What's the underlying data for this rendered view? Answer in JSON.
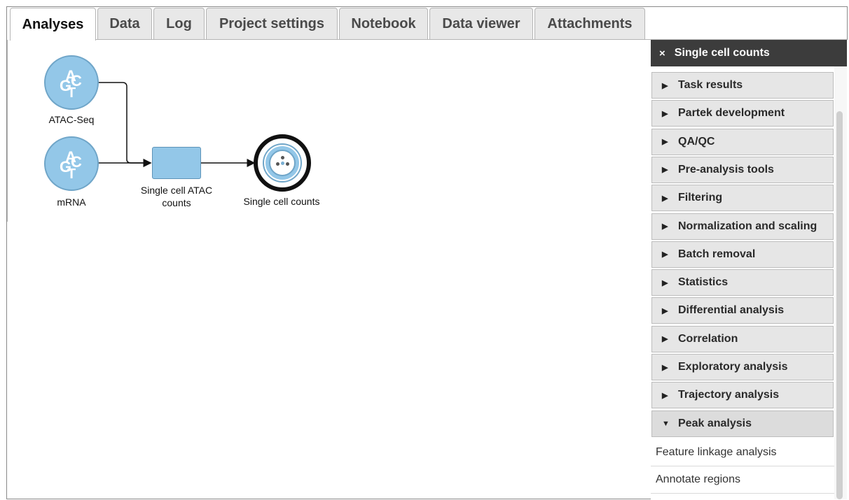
{
  "tabs": [
    {
      "label": "Analyses",
      "active": true
    },
    {
      "label": "Data",
      "active": false
    },
    {
      "label": "Log",
      "active": false
    },
    {
      "label": "Project settings",
      "active": false
    },
    {
      "label": "Notebook",
      "active": false
    },
    {
      "label": "Data viewer",
      "active": false
    },
    {
      "label": "Attachments",
      "active": false
    }
  ],
  "canvas": {
    "nodes": {
      "atac": {
        "label": "ATAC-Seq",
        "icon": "dna-data-icon"
      },
      "mrna": {
        "label": "mRNA",
        "icon": "dna-data-icon"
      },
      "task": {
        "label_line1": "Single cell ATAC",
        "label_line2": "counts"
      },
      "counts": {
        "label": "Single cell counts",
        "icon": "single-cell-icon"
      }
    }
  },
  "panel": {
    "title": "Single cell counts",
    "close_icon": "×",
    "sections": [
      {
        "label": "Task results",
        "expanded": false
      },
      {
        "label": "Partek development",
        "expanded": false
      },
      {
        "label": "QA/QC",
        "expanded": false
      },
      {
        "label": "Pre-analysis tools",
        "expanded": false
      },
      {
        "label": "Filtering",
        "expanded": false
      },
      {
        "label": "Normalization and scaling",
        "expanded": false
      },
      {
        "label": "Batch removal",
        "expanded": false
      },
      {
        "label": "Statistics",
        "expanded": false
      },
      {
        "label": "Differential analysis",
        "expanded": false
      },
      {
        "label": "Correlation",
        "expanded": false
      },
      {
        "label": "Exploratory analysis",
        "expanded": false
      },
      {
        "label": "Trajectory analysis",
        "expanded": false
      },
      {
        "label": "Peak analysis",
        "expanded": true
      }
    ],
    "subitems": [
      {
        "label": "Feature linkage analysis"
      },
      {
        "label": "Annotate regions"
      }
    ]
  },
  "colors": {
    "node_fill": "#93c7e8",
    "header_bg": "#3c3c3c",
    "section_bg": "#e6e6e6"
  }
}
